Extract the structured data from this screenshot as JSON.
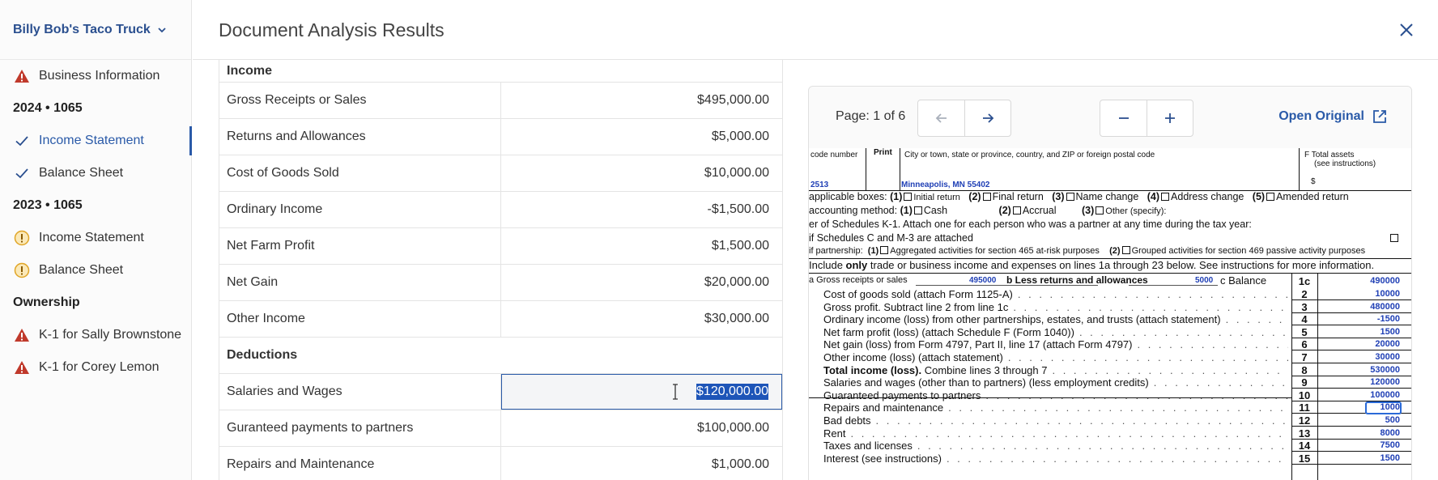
{
  "sidebar": {
    "company": "Billy Bob's Taco Truck",
    "items": [
      {
        "type": "item",
        "label": "Business Information",
        "status": "warning"
      },
      {
        "type": "heading",
        "label": "2024 • 1065"
      },
      {
        "type": "item",
        "label": "Income Statement",
        "status": "done",
        "active": true
      },
      {
        "type": "item",
        "label": "Balance Sheet",
        "status": "done"
      },
      {
        "type": "heading",
        "label": "2023 • 1065"
      },
      {
        "type": "item",
        "label": "Income Statement",
        "status": "alert"
      },
      {
        "type": "item",
        "label": "Balance Sheet",
        "status": "alert"
      },
      {
        "type": "heading",
        "label": "Ownership"
      },
      {
        "type": "item",
        "label": "K-1 for Sally Brownstone",
        "status": "warning"
      },
      {
        "type": "item",
        "label": "K-1 for Corey Lemon",
        "status": "warning"
      }
    ]
  },
  "header": {
    "title": "Document Analysis Results"
  },
  "table": {
    "income_heading": "Income",
    "income_rows": [
      {
        "label": "Gross Receipts or Sales",
        "value": "$495,000.00"
      },
      {
        "label": "Returns and Allowances",
        "value": "$5,000.00"
      },
      {
        "label": "Cost of Goods Sold",
        "value": "$10,000.00"
      },
      {
        "label": "Ordinary Income",
        "value": "-$1,500.00"
      },
      {
        "label": "Net Farm Profit",
        "value": "$1,500.00"
      },
      {
        "label": "Net Gain",
        "value": "$20,000.00"
      },
      {
        "label": "Other Income",
        "value": "$30,000.00"
      }
    ],
    "deductions_heading": "Deductions",
    "deduction_rows": [
      {
        "label": "Salaries and Wages",
        "value": "$120,000.00",
        "selected": true
      },
      {
        "label": "Guranteed payments to partners",
        "value": "$100,000.00"
      },
      {
        "label": "Repairs and Maintenance",
        "value": "$1,000.00"
      }
    ]
  },
  "viewer": {
    "page_label": "Page: 1 of 6",
    "open_original": "Open Original",
    "form": {
      "hdr_code": "code number",
      "hdr_print": "Print",
      "hdr_city": "City or town, state or province, country, and ZIP or foreign postal code",
      "hdr_assets": "F  Total assets",
      "hdr_assets2": "(see instructions)",
      "code_value": "2513",
      "city_value": "Minneapolis, MN 55402",
      "dollar": "$",
      "line_g": "applicable boxes:",
      "line_g_opts": [
        "(1)",
        "Initial return",
        "(2)",
        "Final return",
        "(3)",
        "Name change",
        "(4)",
        "Address change",
        "(5)",
        "Amended return"
      ],
      "line_h": "accounting method:",
      "line_h_opts": [
        "(1)",
        "Cash",
        "(2)",
        "Accrual",
        "(3)",
        "Other (specify):"
      ],
      "line_i": "er of Schedules K-1. Attach one for each person who was a partner at any time during the tax year:",
      "line_j": "if Schedules C and M-3 are attached",
      "line_k": "if partnership:",
      "line_k_opts": [
        "(1)",
        "Aggregated activities for section 465 at-risk purposes",
        "(2)",
        "Grouped activities for section 469 passive activity purposes"
      ],
      "caution_pre": "Include ",
      "caution_bold": "only",
      "caution_post": " trade or business income and expenses on lines 1a through 23 below. See instructions for more information.",
      "l1a": "a  Gross receipts or sales",
      "l1a_val": "495000",
      "l1b": "b  Less returns and allowances",
      "l1b_val": "5000",
      "l1c": "c  Balance",
      "l1c_num": "1c",
      "l1c_amt": "490000",
      "lines": [
        {
          "text": "Cost of goods sold (attach Form 1125-A)",
          "num": "2",
          "amt": "10000"
        },
        {
          "text": "Gross profit. Subtract line 2 from line 1c",
          "num": "3",
          "amt": "480000"
        },
        {
          "text": "Ordinary income (loss) from other partnerships, estates, and trusts (attach statement)",
          "num": "4",
          "amt": "-1500"
        },
        {
          "text": "Net farm profit (loss) (attach Schedule F (Form 1040))",
          "num": "5",
          "amt": "1500"
        },
        {
          "text": "Net gain (loss) from Form 4797, Part II, line 17 (attach Form 4797)",
          "num": "6",
          "amt": "20000"
        },
        {
          "text": "Other income (loss) (attach statement)",
          "num": "7",
          "amt": "30000"
        },
        {
          "text": "Total income (loss).",
          "text2": " Combine lines 3 through 7",
          "num": "8",
          "amt": "530000",
          "bold": true
        },
        {
          "text": "Salaries and wages (other than to partners) (less employment credits)",
          "num": "9",
          "amt": "120000",
          "highlight": true
        },
        {
          "text": "Guaranteed payments to partners",
          "num": "10",
          "amt": "100000"
        },
        {
          "text": "Repairs and maintenance",
          "num": "11",
          "amt": "1000"
        },
        {
          "text": "Bad debts",
          "num": "12",
          "amt": "500"
        },
        {
          "text": "Rent",
          "num": "13",
          "amt": "8000"
        },
        {
          "text": "Taxes and licenses",
          "num": "14",
          "amt": "7500"
        },
        {
          "text": "Interest (see instructions)",
          "num": "15",
          "amt": "1500"
        }
      ]
    }
  },
  "colors": {
    "accent": "#2a5aa8",
    "warning": "#c0392b",
    "alert": "#e0a526",
    "selection": "#1e55b8"
  }
}
